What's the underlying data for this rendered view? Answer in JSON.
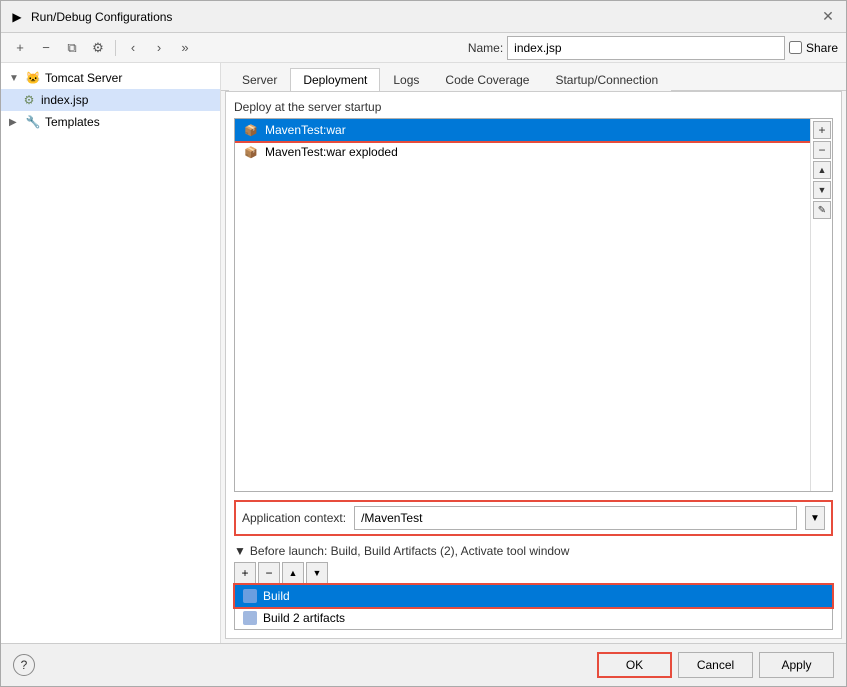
{
  "titleBar": {
    "icon": "▶",
    "title": "Run/Debug Configurations",
    "closeBtn": "✕"
  },
  "toolbar": {
    "addBtn": "+",
    "removeBtn": "−",
    "copyBtn": "⧉",
    "configBtn": "⚙",
    "chevronLeft": "‹",
    "chevronRight": "›",
    "moreBtn": "»"
  },
  "nameRow": {
    "label": "Name:",
    "value": "index.jsp",
    "shareLabel": "Share"
  },
  "sidebar": {
    "tomcatServer": {
      "label": "Tomcat Server",
      "child": "index.jsp"
    },
    "templates": {
      "label": "Templates"
    }
  },
  "tabs": {
    "items": [
      "Server",
      "Deployment",
      "Logs",
      "Code Coverage",
      "Startup/Connection"
    ],
    "active": 1
  },
  "deployment": {
    "sectionLabel": "Deploy at the server startup",
    "items": [
      {
        "label": "MavenTest:war",
        "selected": true
      },
      {
        "label": "MavenTest:war exploded",
        "selected": false
      }
    ],
    "listBtns": [
      "+",
      "−",
      "↑",
      "↓",
      "✎"
    ],
    "appContext": {
      "label": "Application context:",
      "value": "/MavenTest"
    }
  },
  "beforeLaunch": {
    "header": "Before launch: Build, Build Artifacts (2), Activate tool window",
    "items": [
      {
        "label": "Build",
        "selected": true
      },
      {
        "label": "Build 2 artifacts",
        "selected": false
      }
    ],
    "toolbarBtns": [
      "+",
      "−",
      "↑",
      "↓"
    ]
  },
  "bottomBar": {
    "helpBtn": "?",
    "okBtn": "OK",
    "cancelBtn": "Cancel",
    "applyBtn": "Apply"
  }
}
